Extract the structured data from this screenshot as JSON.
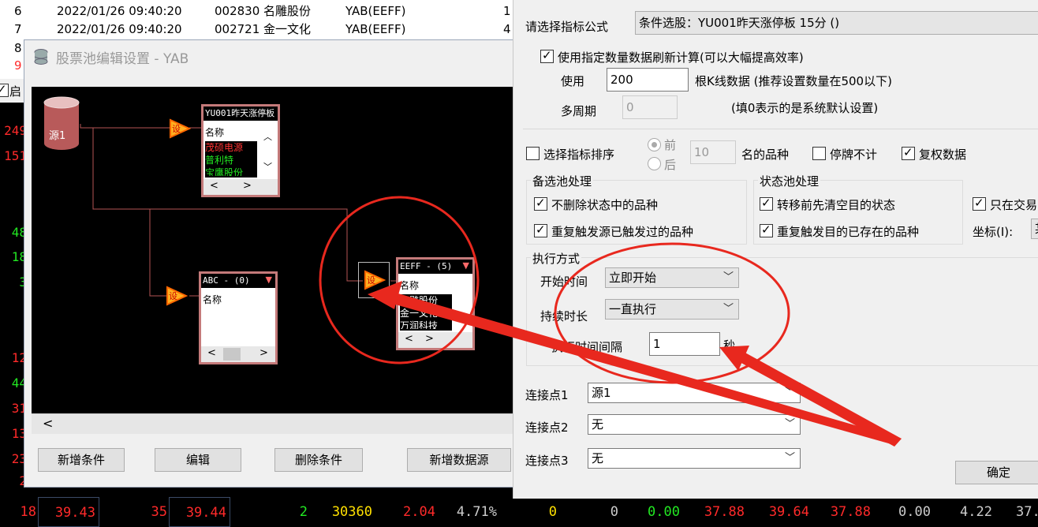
{
  "background_list": {
    "rows": [
      {
        "num": "6",
        "time": "2022/01/26 09:40:20",
        "stock": "002830 名雕股份",
        "pool": "YAB(EEFF)",
        "extra": "1"
      },
      {
        "num": "7",
        "time": "2022/01/26 09:40:20",
        "stock": "002721 金一文化",
        "pool": "YAB(EEFF)",
        "extra": "4"
      },
      {
        "num": "8",
        "time": "",
        "stock": "",
        "pool": "",
        "extra": ""
      },
      {
        "num": "9",
        "time": "",
        "stock": "",
        "pool": "",
        "extra": ""
      }
    ],
    "enable_label": "启",
    "left_numbers": [
      "249",
      "151",
      "48",
      "18",
      "3",
      "12",
      "44",
      "31",
      "13",
      "23",
      "2"
    ]
  },
  "ticker_row": [
    "18",
    "39.43",
    "35",
    "39.44",
    "2",
    "30360",
    "2.04",
    "4.71%",
    "0",
    "0",
    "0.00",
    "37.88",
    "39.64",
    "37.88",
    "0.00",
    "4.22",
    "37."
  ],
  "dialog": {
    "title": "股票池编辑设置 - YAB",
    "source_label": "源1",
    "node_label": "设",
    "pools": [
      {
        "header": "YU001昨天涨停板",
        "col": "名称",
        "items": [
          "茂硕电源",
          "普利特",
          "宝鹰股份"
        ]
      },
      {
        "header": "ABC - (0)",
        "col": "名称",
        "items": []
      },
      {
        "header": "EEFF - (5)",
        "col": "名称",
        "items": [
          "名雕股份",
          "金一文化",
          "万润科技"
        ]
      }
    ],
    "buttons": {
      "add_condition": "新增条件",
      "edit": "编辑",
      "delete_condition": "删除条件",
      "add_source": "新增数据源"
    }
  },
  "panel": {
    "formula_label": "请选择指标公式",
    "formula_value": "条件选股：YU001昨天涨停板 15分 ()",
    "use_count_label": "使用指定数量数据刷新计算(可以大幅提高效率)",
    "use_label": "使用",
    "use_value": "200",
    "kline_hint": "根K线数据 (推荐设置数量在500以下)",
    "multi_period_label": "多周期",
    "multi_period_value": "0",
    "multi_period_hint": "(填0表示的是系统默认设置)",
    "sort_label": "选择指标排序",
    "front_label": "前",
    "back_label": "后",
    "top_n_value": "10",
    "top_n_suffix": "名的品种",
    "suspend_label": "停牌不计",
    "adjust_label": "复权数据",
    "candidate_group": "备选池处理",
    "no_delete_label": "不删除状态中的品种",
    "repeat_source_label": "重复触发源已触发过的品种",
    "state_group": "状态池处理",
    "clear_target_label": "转移前先清空目的状态",
    "repeat_target_label": "重复触发目的已存在的品种",
    "trading_only_label": "只在交易",
    "coord_label": "坐标(I):",
    "coord_value": "某",
    "exec_group": "执行方式",
    "start_time_label": "开始时间",
    "start_time_value": "立即开始",
    "duration_label": "持续时长",
    "duration_value": "一直执行",
    "interval_label": "执行时间间隔",
    "interval_value": "1",
    "interval_unit": "秒",
    "connect1_label": "连接点1",
    "connect1_value": "源1",
    "connect2_label": "连接点2",
    "connect2_value": "无",
    "connect3_label": "连接点3",
    "connect3_value": "无",
    "ok_button": "确定"
  },
  "colors": {
    "red": "#ff2a2a",
    "green": "#22e822",
    "yellow": "#ffe000",
    "annotation": "#e8281e",
    "pool_border": "#c47a7a"
  }
}
